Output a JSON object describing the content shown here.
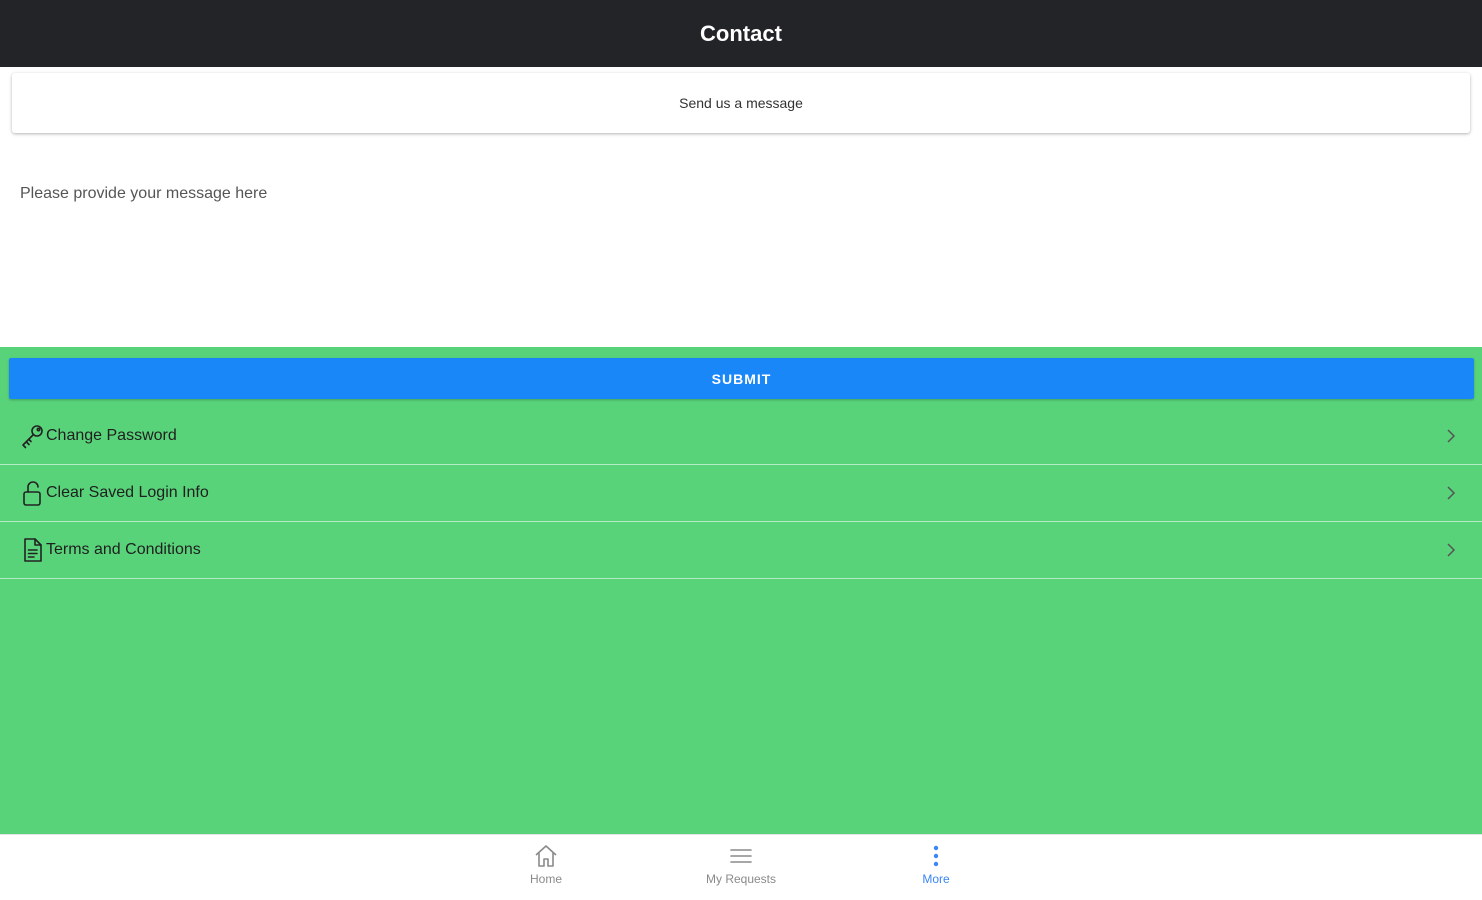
{
  "header": {
    "title": "Contact"
  },
  "card": {
    "label": "Send us a message"
  },
  "message": {
    "placeholder": "Please provide your message here",
    "value": ""
  },
  "submit": {
    "label": "SUBMIT"
  },
  "menu": {
    "items": [
      {
        "label": "Change Password",
        "icon": "key-icon"
      },
      {
        "label": "Clear Saved Login Info",
        "icon": "unlock-icon"
      },
      {
        "label": "Terms and Conditions",
        "icon": "document-icon"
      }
    ]
  },
  "tabs": {
    "items": [
      {
        "label": "Home",
        "icon": "home-icon",
        "active": false
      },
      {
        "label": "My Requests",
        "icon": "list-icon",
        "active": false
      },
      {
        "label": "More",
        "icon": "more-vertical-icon",
        "active": true
      }
    ]
  },
  "colors": {
    "header_bg": "#222428",
    "green_bg": "#59d37a",
    "submit_bg": "#1a87f9",
    "active_tab": "#3a86f5"
  }
}
